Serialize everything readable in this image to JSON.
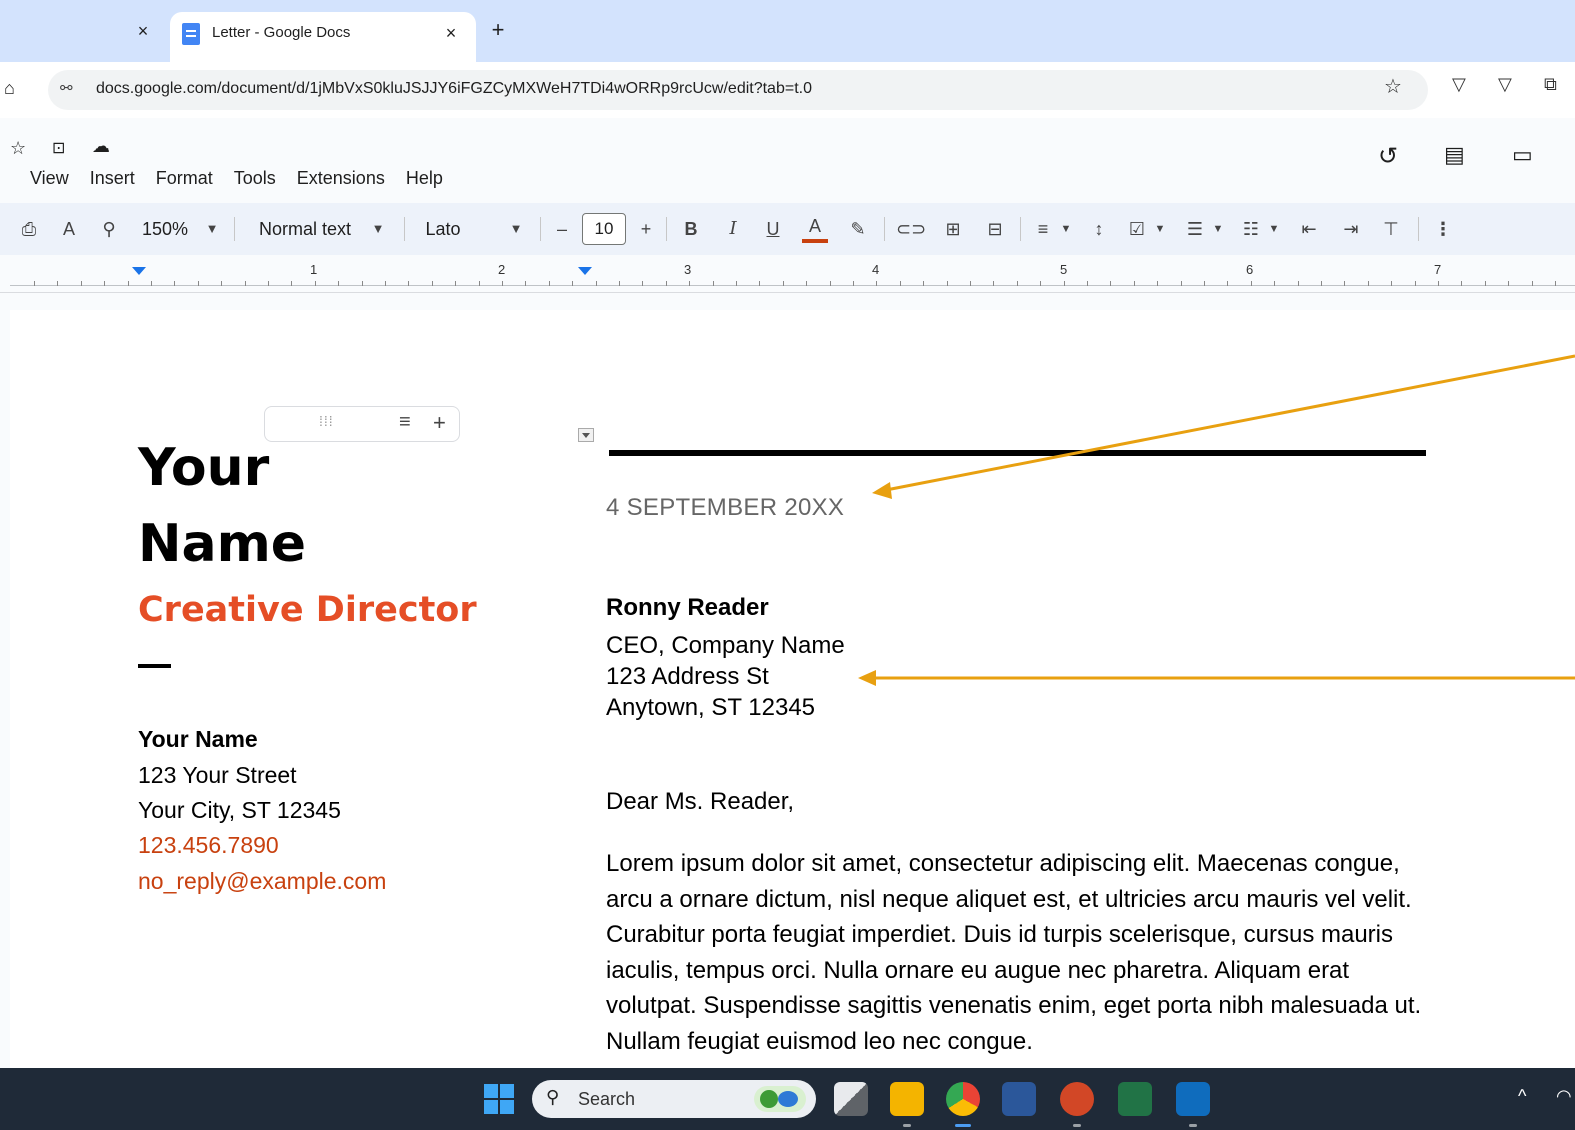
{
  "browser": {
    "prev_tab_close": "×",
    "tab_title": "Letter - Google Docs",
    "tab_close": "×",
    "new_tab": "+",
    "url": "docs.google.com/document/d/1jMbVxS0kluJSJJY6iFGZCyMXWeH7TDi4wORRp9rcUcw/edit?tab=t.0"
  },
  "docs": {
    "menu": [
      "View",
      "Insert",
      "Format",
      "Tools",
      "Extensions",
      "Help"
    ],
    "toolbar": {
      "zoom": "150%",
      "style": "Normal text",
      "font": "Lato",
      "font_size": "10",
      "minus": "–",
      "plus": "+",
      "bold": "B",
      "italic": "I",
      "underline": "U",
      "text_color": "A"
    },
    "ruler_numbers": [
      "1",
      "2",
      "3",
      "4",
      "5",
      "6",
      "7"
    ]
  },
  "document": {
    "sidebar": {
      "name_line1": "Your",
      "name_line2": "Name",
      "role": "Creative Director",
      "contact_name": "Your Name",
      "street": "123 Your Street",
      "city": "Your City, ST 12345",
      "phone": "123.456.7890",
      "email": "no_reply@example.com"
    },
    "letter": {
      "date": "4 SEPTEMBER 20XX",
      "recipient_name": "Ronny Reader",
      "recipient_title": "CEO, Company Name",
      "recipient_street": "123 Address St",
      "recipient_city": "Anytown, ST 12345",
      "salutation": "Dear Ms. Reader,",
      "body": "Lorem ipsum dolor sit amet, consectetur adipiscing elit. Maecenas congue, arcu a ornare dictum, nisl neque aliquet est, et ultricies arcu mauris vel velit. Curabitur porta feugiat imperdiet. Duis id turpis scelerisque, cursus mauris iaculis, tempus orci. Nulla ornare eu augue nec pharetra. Aliquam erat volutpat. Suspendisse sagittis venenatis enim, eget porta nibh malesuada ut. Nullam feugiat euismod leo nec congue."
    }
  },
  "taskbar": {
    "search_label": "Search"
  },
  "colors": {
    "accent_orange": "#e54e26",
    "contact_orange": "#c8410f",
    "annotation_arrow": "#e8a010",
    "tab_bar": "#d3e3fd"
  }
}
